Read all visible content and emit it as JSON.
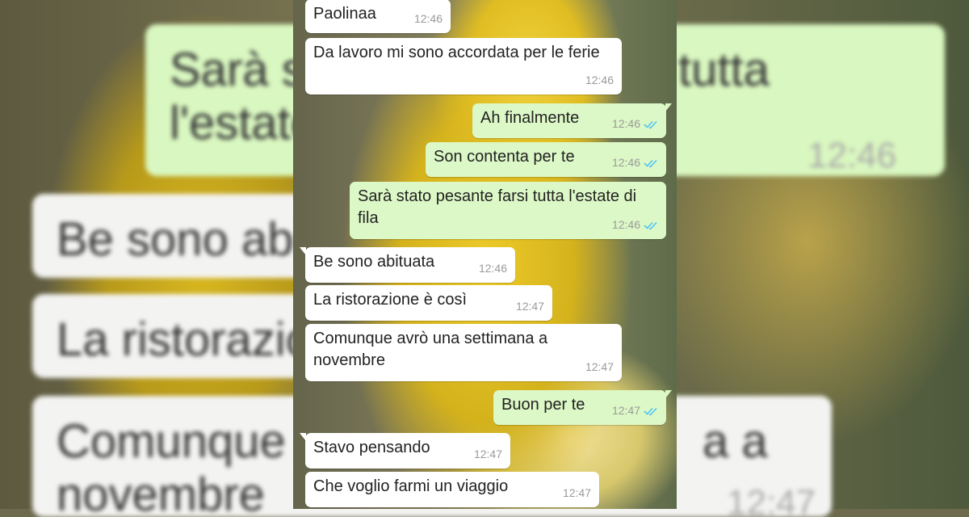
{
  "colors": {
    "incoming_bubble": "#ffffff",
    "outgoing_bubble": "#dcf8c6",
    "read_ticks": "#4fc3f7",
    "time_text": "#9a9a9a"
  },
  "background_echo": {
    "top_out_line1": "Sarà s",
    "top_out_line1b": "tutta",
    "top_out_line2": "l'estate",
    "top_out_time": "12:46",
    "in1": "Be sono abi",
    "in2": "La ristorazio",
    "in3_line1": "Comunque",
    "in3_line1b": "a a",
    "in3_line2": "novembre",
    "in3_time": "12:47"
  },
  "messages": [
    {
      "dir": "in",
      "text": "Paolinaa",
      "time": "12:46"
    },
    {
      "dir": "in",
      "text": "Da lavoro mi sono accordata per le ferie",
      "time": "12:46"
    },
    {
      "dir": "out",
      "text": "Ah finalmente",
      "time": "12:46",
      "status_icon": "double-check-read-icon"
    },
    {
      "dir": "out",
      "text": "Son contenta per te",
      "time": "12:46",
      "status_icon": "double-check-read-icon"
    },
    {
      "dir": "out",
      "text": "Sarà stato pesante farsi tutta l'estate di fila",
      "time": "12:46",
      "status_icon": "double-check-read-icon"
    },
    {
      "dir": "in",
      "text": "Be sono abituata",
      "time": "12:46"
    },
    {
      "dir": "in",
      "text": "La ristorazione è così",
      "time": "12:47"
    },
    {
      "dir": "in",
      "text": "Comunque avrò una settimana a novembre",
      "time": "12:47"
    },
    {
      "dir": "out",
      "text": "Buon per te",
      "time": "12:47",
      "status_icon": "double-check-read-icon"
    },
    {
      "dir": "in",
      "text": "Stavo pensando",
      "time": "12:47"
    },
    {
      "dir": "in",
      "text": "Che voglio farmi un viaggio",
      "time": "12:47"
    }
  ]
}
